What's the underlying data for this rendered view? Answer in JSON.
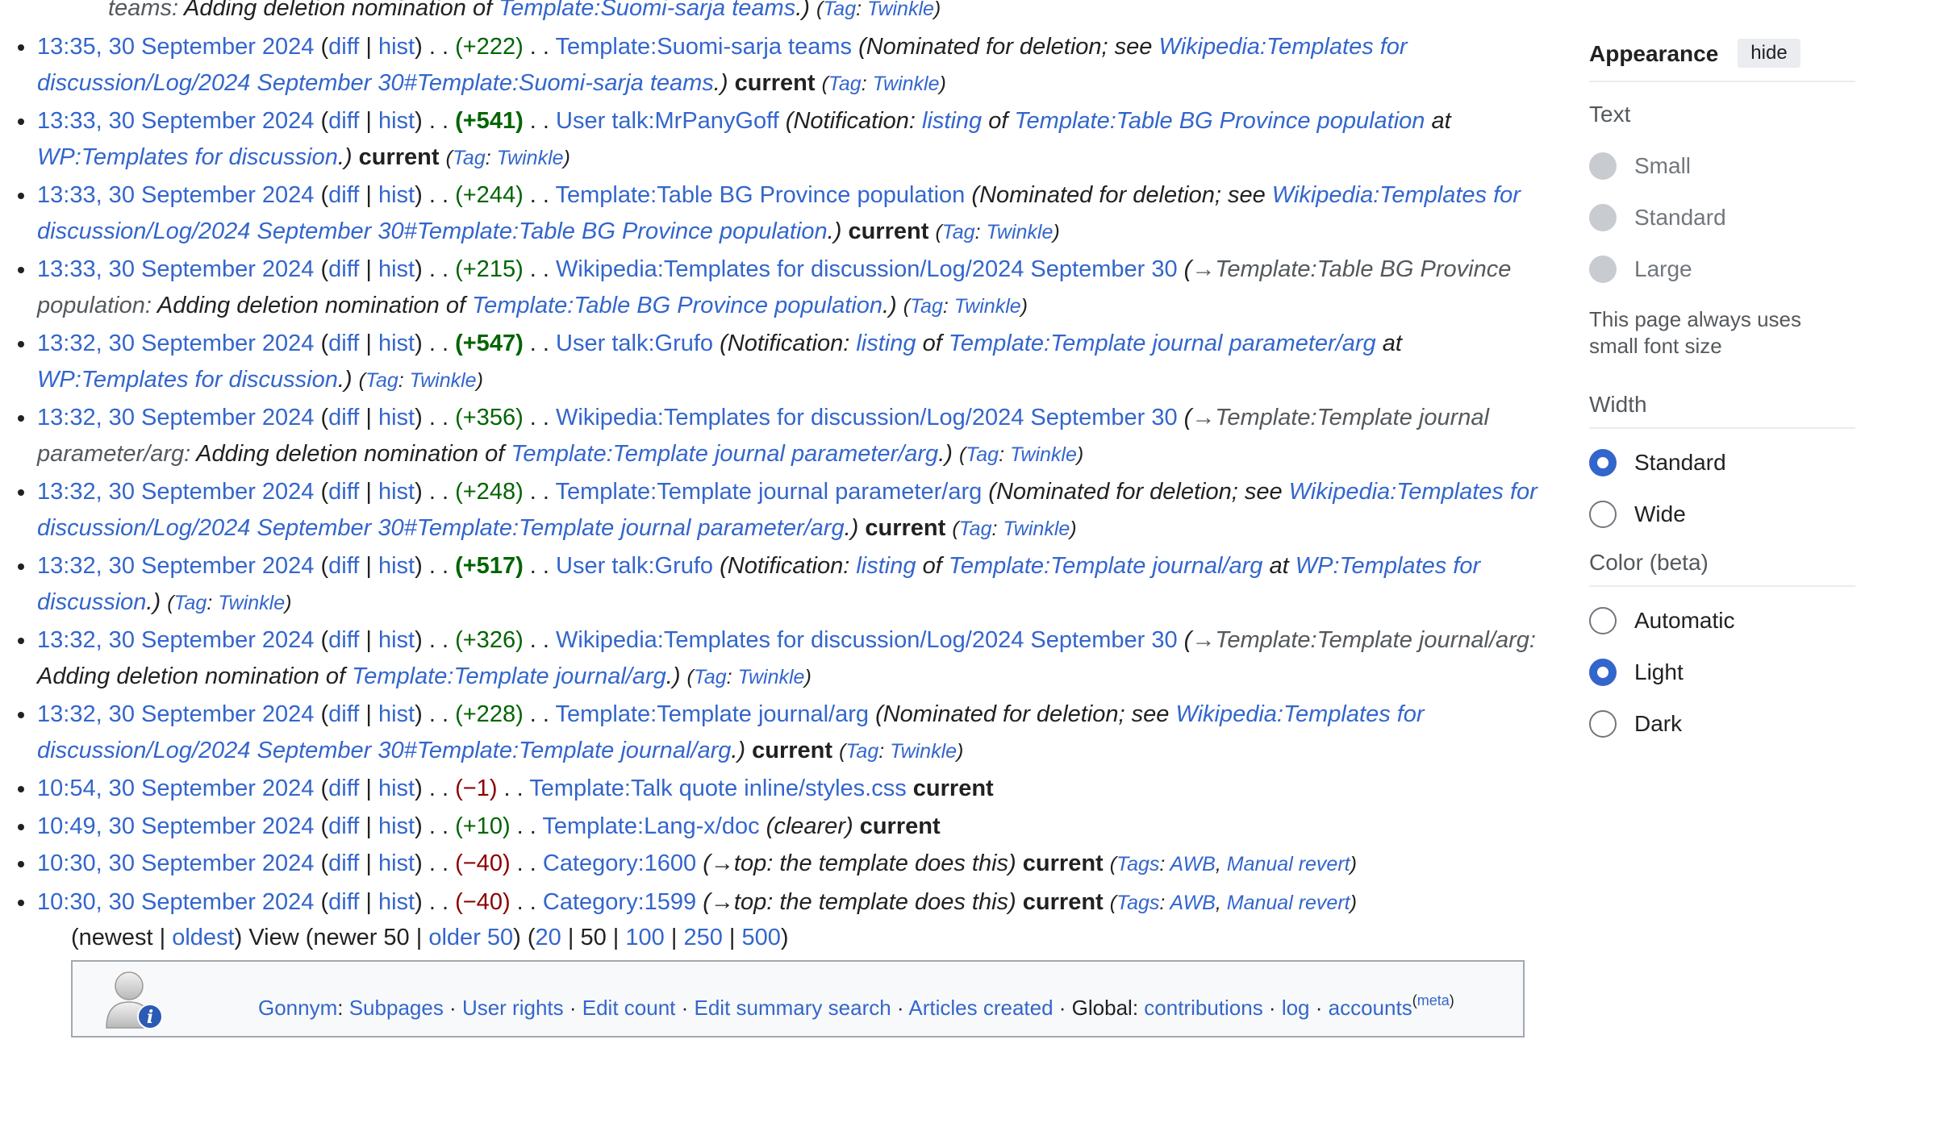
{
  "top_fragment": {
    "prefix": "teams:",
    "text": " Adding deletion nomination of ",
    "link": "Template:Suomi-sarja teams",
    "after": ".)",
    "tag_word": "Tag",
    "tag": "Twinkle"
  },
  "entries": [
    {
      "time": "13:35, 30 September 2024",
      "diff": "diff",
      "hist": "hist",
      "delta": "+222",
      "page": "Template:Suomi-sarja teams",
      "comment_pre": "Nominated for deletion; see ",
      "comment_link": "Wikipedia:Templates for discussion/Log/2024 September 30#Template:Suomi-sarja teams",
      "comment_post": ".)",
      "current": "current",
      "tag_word": "Tag",
      "tags": "Twinkle"
    },
    {
      "time": "13:33, 30 September 2024",
      "diff": "diff",
      "hist": "hist",
      "delta": "+541",
      "page": "User talk:MrPanyGoff",
      "comment_pre": "Notification: ",
      "comment_link": "listing",
      "comment_mid": " of ",
      "comment_link2": "Template:Table BG Province population",
      "comment_mid2": " at ",
      "comment_link3": "WP:Templates for discussion",
      "comment_post": ".)",
      "current": "current",
      "tag_word": "Tag",
      "tags": "Twinkle"
    },
    {
      "time": "13:33, 30 September 2024",
      "diff": "diff",
      "hist": "hist",
      "delta": "+244",
      "page": "Template:Table BG Province population",
      "comment_pre": "Nominated for deletion; see ",
      "comment_link": "Wikipedia:Templates for discussion/Log/2024 September 30#Template:Table BG Province population",
      "comment_post": ".)",
      "current": "current",
      "tag_word": "Tag",
      "tags": "Twinkle"
    },
    {
      "time": "13:33, 30 September 2024",
      "diff": "diff",
      "hist": "hist",
      "delta": "+215",
      "page": "Wikipedia:Templates for discussion/Log/2024 September 30",
      "comment_section": "→Template:Table BG Province population:",
      "comment_pre": " Adding deletion nomination of ",
      "comment_link": "Template:Table BG Province population",
      "comment_post": ".)",
      "tag_word": "Tag",
      "tags": "Twinkle"
    },
    {
      "time": "13:32, 30 September 2024",
      "diff": "diff",
      "hist": "hist",
      "delta": "+547",
      "page": "User talk:Grufo",
      "comment_pre": "Notification: ",
      "comment_link": "listing",
      "comment_mid": " of ",
      "comment_link2": "Template:Template journal parameter/arg",
      "comment_mid2": " at ",
      "comment_link3": "WP:Templates for discussion",
      "comment_post": ".)",
      "tag_word": "Tag",
      "tags": "Twinkle"
    },
    {
      "time": "13:32, 30 September 2024",
      "diff": "diff",
      "hist": "hist",
      "delta": "+356",
      "page": "Wikipedia:Templates for discussion/Log/2024 September 30",
      "comment_section": "→Template:Template journal parameter/arg:",
      "comment_pre": " Adding deletion nomination of ",
      "comment_link": "Template:Template journal parameter/arg",
      "comment_post": ".)",
      "tag_word": "Tag",
      "tags": "Twinkle"
    },
    {
      "time": "13:32, 30 September 2024",
      "diff": "diff",
      "hist": "hist",
      "delta": "+248",
      "page": "Template:Template journal parameter/arg",
      "comment_pre": "Nominated for deletion; see ",
      "comment_link": "Wikipedia:Templates for discussion/Log/2024 September 30#Template:Template journal parameter/arg",
      "comment_post": ".)",
      "current": "current",
      "tag_word": "Tag",
      "tags": "Twinkle"
    },
    {
      "time": "13:32, 30 September 2024",
      "diff": "diff",
      "hist": "hist",
      "delta": "+517",
      "page": "User talk:Grufo",
      "comment_pre": "Notification: ",
      "comment_link": "listing",
      "comment_mid": " of ",
      "comment_link2": "Template:Template journal/arg",
      "comment_mid2": " at ",
      "comment_link3": "WP:Templates for discussion",
      "comment_post": ".)",
      "tag_word": "Tag",
      "tags": "Twinkle"
    },
    {
      "time": "13:32, 30 September 2024",
      "diff": "diff",
      "hist": "hist",
      "delta": "+326",
      "page": "Wikipedia:Templates for discussion/Log/2024 September 30",
      "comment_section": "→Template:Template journal/arg:",
      "comment_pre": " Adding deletion nomination of ",
      "comment_link": "Template:Template journal/arg",
      "comment_post": ".)",
      "tag_word": "Tag",
      "tags": "Twinkle"
    },
    {
      "time": "13:32, 30 September 2024",
      "diff": "diff",
      "hist": "hist",
      "delta": "+228",
      "page": "Template:Template journal/arg",
      "comment_pre": "Nominated for deletion; see ",
      "comment_link": "Wikipedia:Templates for discussion/Log/2024 September 30#Template:Template journal/arg",
      "comment_post": ".)",
      "current": "current",
      "tag_word": "Tag",
      "tags": "Twinkle"
    },
    {
      "time": "10:54, 30 September 2024",
      "diff": "diff",
      "hist": "hist",
      "delta": "−1",
      "page": "Template:Talk quote inline/styles.css",
      "current": "current"
    },
    {
      "time": "10:49, 30 September 2024",
      "diff": "diff",
      "hist": "hist",
      "delta": "+10",
      "page": "Template:Lang-x/doc",
      "comment_plain": "(clearer)",
      "current": "current"
    },
    {
      "time": "10:30, 30 September 2024",
      "diff": "diff",
      "hist": "hist",
      "delta": "−40",
      "page": "Category:1600",
      "comment_section": "(→top:",
      "comment_plain_after": " the template does this)",
      "current": "current",
      "tag_word": "Tags",
      "tags": "AWB",
      "tags2": "Manual revert"
    },
    {
      "time": "10:30, 30 September 2024",
      "diff": "diff",
      "hist": "hist",
      "delta": "−40",
      "page": "Category:1599",
      "comment_section": "(→top:",
      "comment_plain_after": " the template does this)",
      "current": "current",
      "tag_word": "Tags",
      "tags": "AWB",
      "tags2": "Manual revert"
    }
  ],
  "pager": {
    "newest": "newest",
    "oldest": "oldest",
    "view": "View",
    "newer": "newer 50",
    "older": "older 50",
    "limits": [
      "20",
      "50",
      "100",
      "250",
      "500"
    ]
  },
  "footer": {
    "user": "Gonnym",
    "links": [
      "Subpages",
      "User rights",
      "Edit count",
      "Edit summary search",
      "Articles created"
    ],
    "global": "Global:",
    "global_links": [
      "contributions",
      "log",
      "accounts"
    ],
    "meta": "meta"
  },
  "appearance": {
    "title": "Appearance",
    "hide": "hide",
    "text_label": "Text",
    "text_options": [
      "Small",
      "Standard",
      "Large"
    ],
    "text_note": "This page always uses small font size",
    "width_label": "Width",
    "width_options": [
      "Standard",
      "Wide"
    ],
    "width_selected": "Standard",
    "color_label": "Color (beta)",
    "color_options": [
      "Automatic",
      "Light",
      "Dark"
    ],
    "color_selected": "Light"
  },
  "colors": {
    "link": "#3366cc",
    "positive": "#006400",
    "negative": "#8b0000"
  }
}
